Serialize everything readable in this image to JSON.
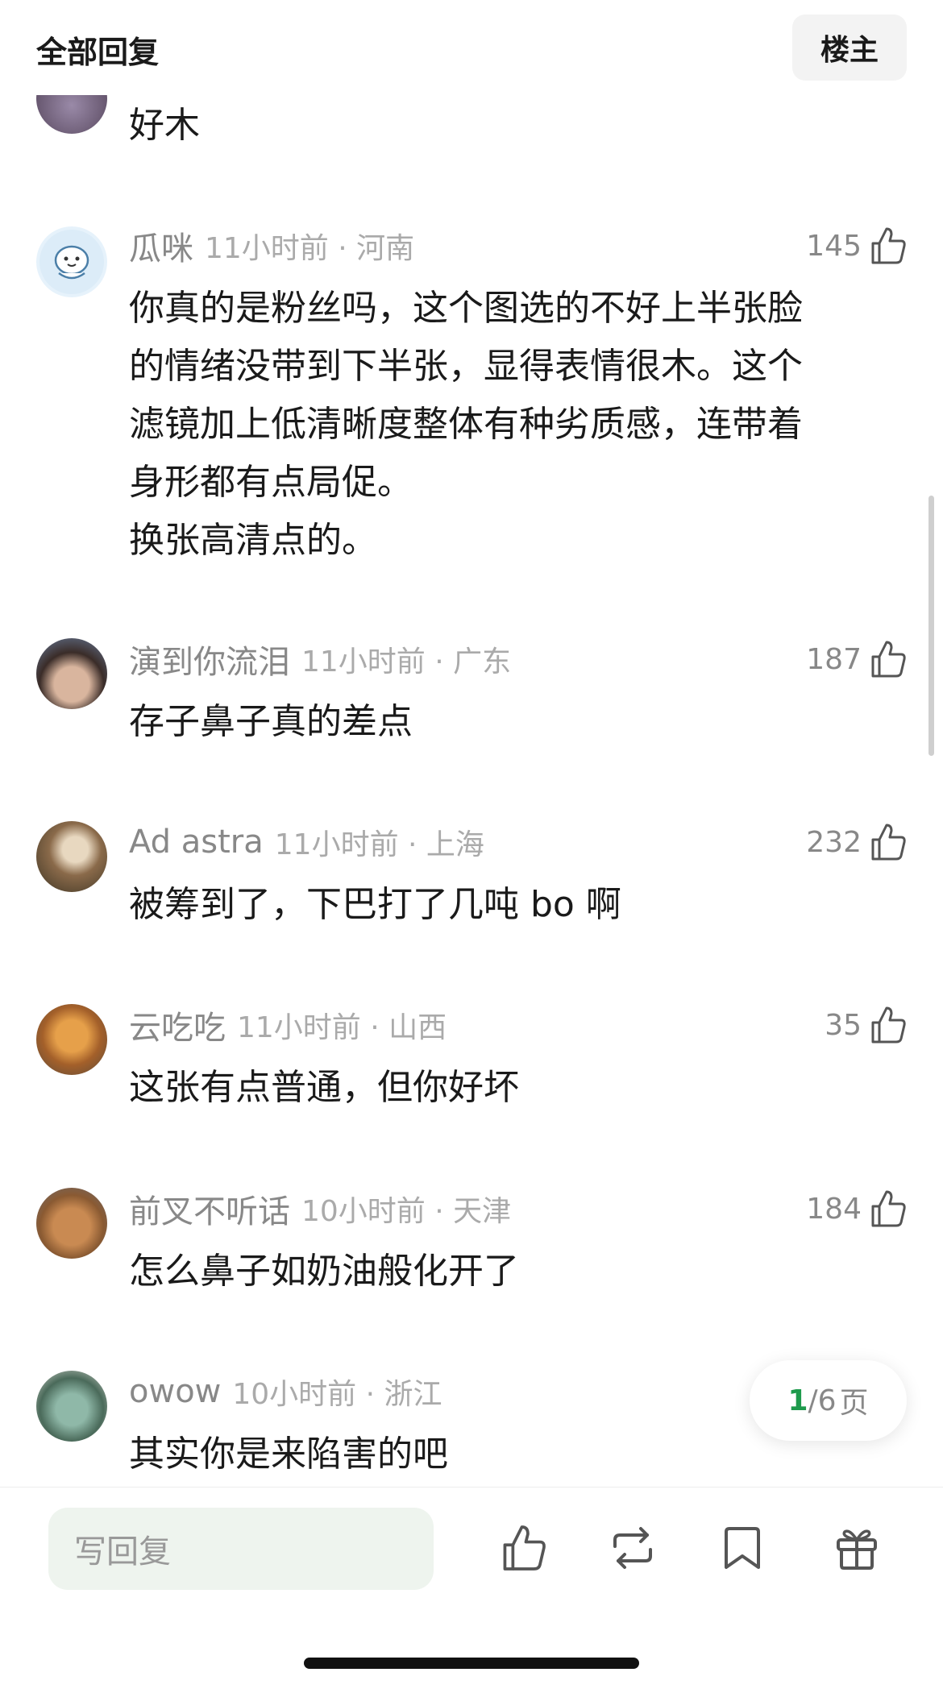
{
  "header": {
    "title": "全部回复",
    "op_button": "楼主"
  },
  "comments": [
    {
      "username": "",
      "time": "",
      "likes": "",
      "text": "好木"
    },
    {
      "username": "瓜咪",
      "time": "11小时前 · 河南",
      "likes": "145",
      "text": "你真的是粉丝吗，这个图选的不好上半张脸\n的情绪没带到下半张，显得表情很木。这个\n滤镜加上低清晰度整体有种劣质感，连带着\n身形都有点局促。\n换张高清点的。"
    },
    {
      "username": "演到你流泪",
      "time": "11小时前 · 广东",
      "likes": "187",
      "text": "存子鼻子真的差点"
    },
    {
      "username": "Ad astra",
      "time": "11小时前 · 上海",
      "likes": "232",
      "text": "被筹到了，下巴打了几吨 bo 啊"
    },
    {
      "username": "云吃吃",
      "time": "11小时前 · 山西",
      "likes": "35",
      "text": "这张有点普通，但你好坏"
    },
    {
      "username": "前叉不听话",
      "time": "10小时前 · 天津",
      "likes": "184",
      "text": "怎么鼻子如奶油般化开了"
    },
    {
      "username": "owow",
      "time": "10小时前 · 浙江",
      "likes": "",
      "text": "其实你是来陷害的吧"
    }
  ],
  "pagination": {
    "current": "1",
    "total": "/6",
    "unit": "页"
  },
  "bottom_bar": {
    "reply_placeholder": "写回复"
  },
  "colors": {
    "accent": "#1e9a4c",
    "meta_gray": "#888888",
    "input_bg": "#eef4ee"
  },
  "icons": [
    "thumbs-up-icon",
    "repost-icon",
    "bookmark-icon",
    "gift-icon"
  ]
}
